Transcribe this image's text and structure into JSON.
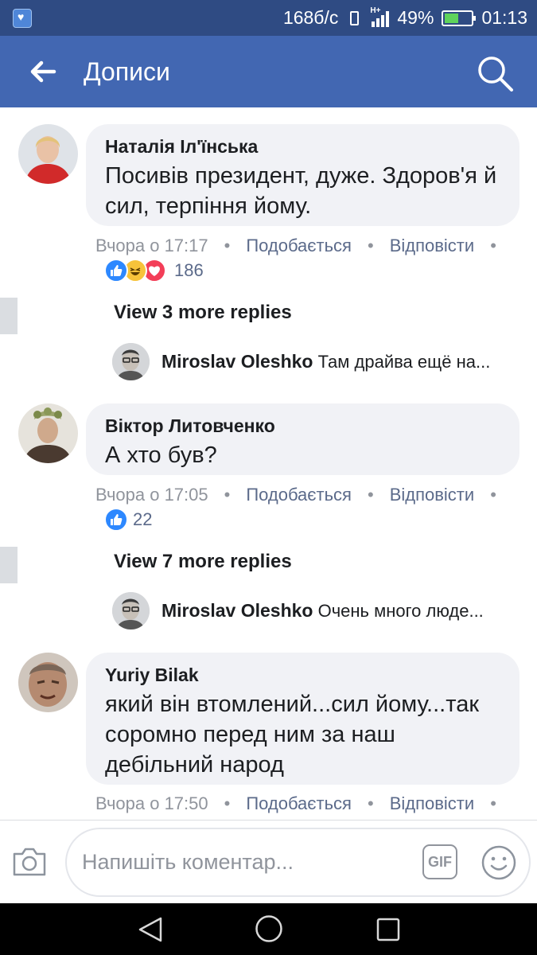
{
  "status_bar": {
    "speed": "168б/с",
    "network": "H+",
    "battery": "49%",
    "time": "01:13"
  },
  "header": {
    "title": "Дописи",
    "back_icon": "arrow-left-icon",
    "search_icon": "search-icon"
  },
  "comments": [
    {
      "author": "Наталія Іл'їнська",
      "text": "Посивів президент, дуже. Здоров'я й сил, терпіння йому.",
      "time": "Вчора о 17:17",
      "like_label": "Подобається",
      "reply_label": "Відповісти",
      "reactions": [
        "like",
        "haha",
        "love"
      ],
      "reaction_count": "186",
      "view_more": "View 3 more replies",
      "reply_preview": {
        "author": "Miroslav Oleshko",
        "text": "Там драйва ещё на..."
      }
    },
    {
      "author": "Віктор Литовченко",
      "text": "А хто був?",
      "time": "Вчора о 17:05",
      "like_label": "Подобається",
      "reply_label": "Відповісти",
      "reactions": [
        "like"
      ],
      "reaction_count": "22",
      "view_more": "View 7 more replies",
      "reply_preview": {
        "author": "Miroslav Oleshko",
        "text": "Очень много люде..."
      }
    },
    {
      "author": "Yuriy Bilak",
      "text": "який він втомлений...сил йому...так соромно перед ним за наш дебільний народ",
      "time": "Вчора о 17:50",
      "like_label": "Подобається",
      "reply_label": "Відповісти"
    }
  ],
  "composer": {
    "placeholder": "Напишіть коментар...",
    "gif_label": "GIF",
    "camera_icon": "camera-icon",
    "emoji_icon": "smiley-icon"
  },
  "colors": {
    "status_bar": "#2f4b83",
    "header": "#4267b2",
    "bubble": "#f1f2f6",
    "link": "#5b6a8a",
    "meta": "#90949c"
  }
}
